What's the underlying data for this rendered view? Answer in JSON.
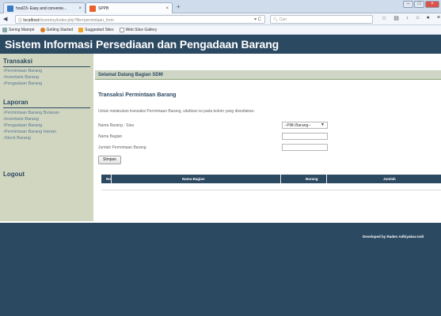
{
  "browser": {
    "tabs": [
      {
        "label": "hosl23- Easy and convenie..."
      },
      {
        "label": "SPPB"
      }
    ],
    "new_tab": "+",
    "url_host": "localhost",
    "url_path": "/inventory/index.php?file=permintaan_form",
    "search_placeholder": "Cari",
    "bookmarks": [
      {
        "label": "Sering Mampir"
      },
      {
        "label": "Getting Started"
      },
      {
        "label": "Suggested Sites"
      },
      {
        "label": "Web Slice Gallery"
      }
    ]
  },
  "site": {
    "title": "Sistem Informasi Persediaan dan Pengadaan Barang"
  },
  "sidebar": {
    "sections": [
      {
        "title": "Transaksi",
        "links": [
          "›Permintaan Barang",
          "›Inventaris Barang",
          "›Pengadaan Barang"
        ]
      },
      {
        "title": "Laporan",
        "links": [
          "›Permintaan Barang Bulanan",
          "›Inventaris Barang",
          "›Pengadaan Barang",
          "›Permintaan Barang Harian",
          "›Stock Barang"
        ]
      }
    ],
    "logout": "Logout"
  },
  "main": {
    "welcome": "Selamat Datang Bagian SDM",
    "form_title": "Transaksi Permintaan Barang",
    "instruction": "Untuk melakukan transaksi Permintaan Barang, silahkan isi pada kolom yang disediakan.",
    "fields": [
      {
        "label": "Nama Barang - Sisa",
        "value": "--Pilih Barang--"
      },
      {
        "label": "Nama Bagian",
        "value": ""
      },
      {
        "label": "Jumlah Permintaan Barang",
        "value": ""
      }
    ],
    "submit": "Simpan",
    "table_headers": [
      "No.",
      "Nama Bagian",
      "Barang",
      "Jumlah"
    ]
  },
  "footer": {
    "credit": "Developed by Raden Adhiyaksa Indi"
  },
  "colors": {
    "header_bg": "#2c4962",
    "sidebar_bg": "#d0d6c0",
    "link": "#5a7894"
  }
}
